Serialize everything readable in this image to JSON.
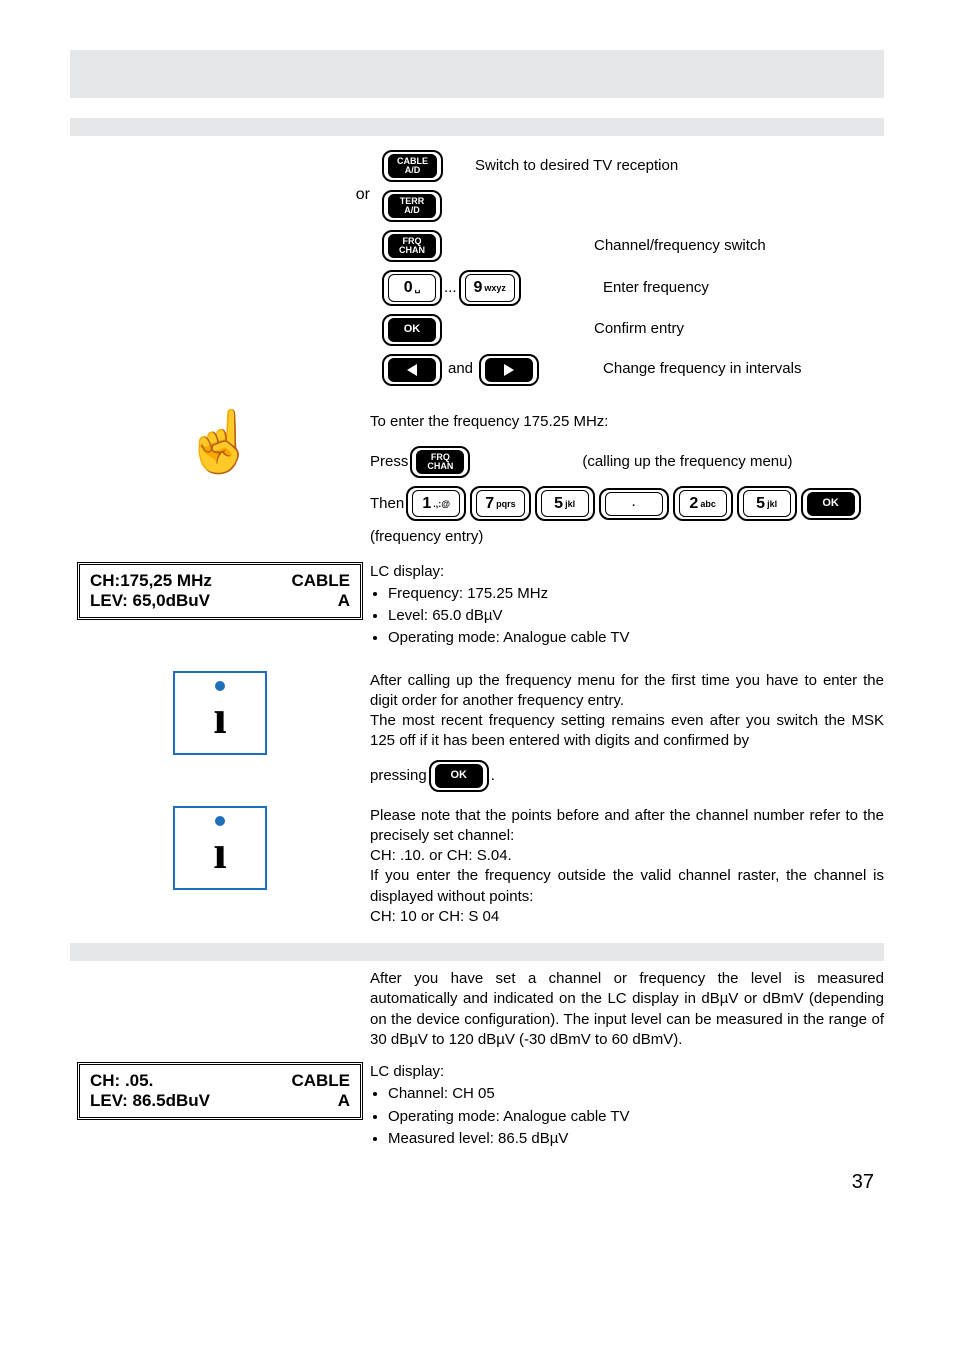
{
  "top": {
    "switch_label": "Switch to desired TV reception",
    "or": "or",
    "cable_key": "CABLE\nA/D",
    "terr_key": "TERR\nA/D",
    "frq_key": "FRQ\nCHAN",
    "ok_key": "OK",
    "zero_key": "0",
    "nine_key_big": "9",
    "nine_key_small": "wxyz",
    "ellipsis": "...",
    "and": "and",
    "chan_freq": "Channel/frequency switch",
    "enter_freq": "Enter frequency",
    "confirm": "Confirm entry",
    "change_intervals": "Change frequency in intervals"
  },
  "example": {
    "intro": "To enter the frequency 175.25 MHz:",
    "press": "Press",
    "calling": "(calling up the frequency menu)",
    "then": "Then",
    "freq_entry": "(frequency entry)",
    "keys": {
      "frq": "FRQ\nCHAN",
      "k1b": "1",
      "k1s": ".,:@",
      "k7b": "7",
      "k7s": "pqrs",
      "k5b": "5",
      "k5s": "jkl",
      "dot": ".",
      "k2b": "2",
      "k2s": "abc",
      "ok": "OK"
    }
  },
  "lcd1": {
    "r1l": "CH:175,25 MHz",
    "r1r": "CABLE",
    "r2l": "LEV: 65,0dBuV",
    "r2r": "A"
  },
  "lcd_info": {
    "title": "LC display:",
    "b1": "Frequency: 175.25 MHz",
    "b2": "Level: 65.0 dBµV",
    "b3": "Operating mode: Analogue cable TV"
  },
  "note1": {
    "p1": "After calling up the frequency menu for the first time you have to enter the digit order for another frequency entry.",
    "p2": "The most recent frequency setting remains even after you switch the MSK 125 off if it has been entered with digits and confirmed by",
    "pressing": "pressing",
    "period": "."
  },
  "note2": {
    "p1": "Please note that the points before and after the channel number refer to the precisely set channel:",
    "l1": "CH: .10.  or  CH: S.04.",
    "p2": "If you enter the frequency outside the valid channel raster, the channel is displayed without points:",
    "l2": "CH:  10   or  CH: S 04"
  },
  "level": {
    "p1": "After you have set a channel or frequency the level is measured automatically and indicated on the LC display in dBµV or dBmV (depending on the device configuration). The input level can be measured in the range of 30 dBµV to 120 dBµV (-30 dBmV to 60 dBmV).",
    "title": "LC display:",
    "b1": "Channel: CH 05",
    "b2": "Operating mode: Analogue cable TV",
    "b3": "Measured level: 86.5 dBµV"
  },
  "lcd2": {
    "r1l": "CH: .05.",
    "r1r": "CABLE",
    "r2l": "LEV: 86.5dBuV",
    "r2r": "A"
  },
  "pagenum": "37"
}
